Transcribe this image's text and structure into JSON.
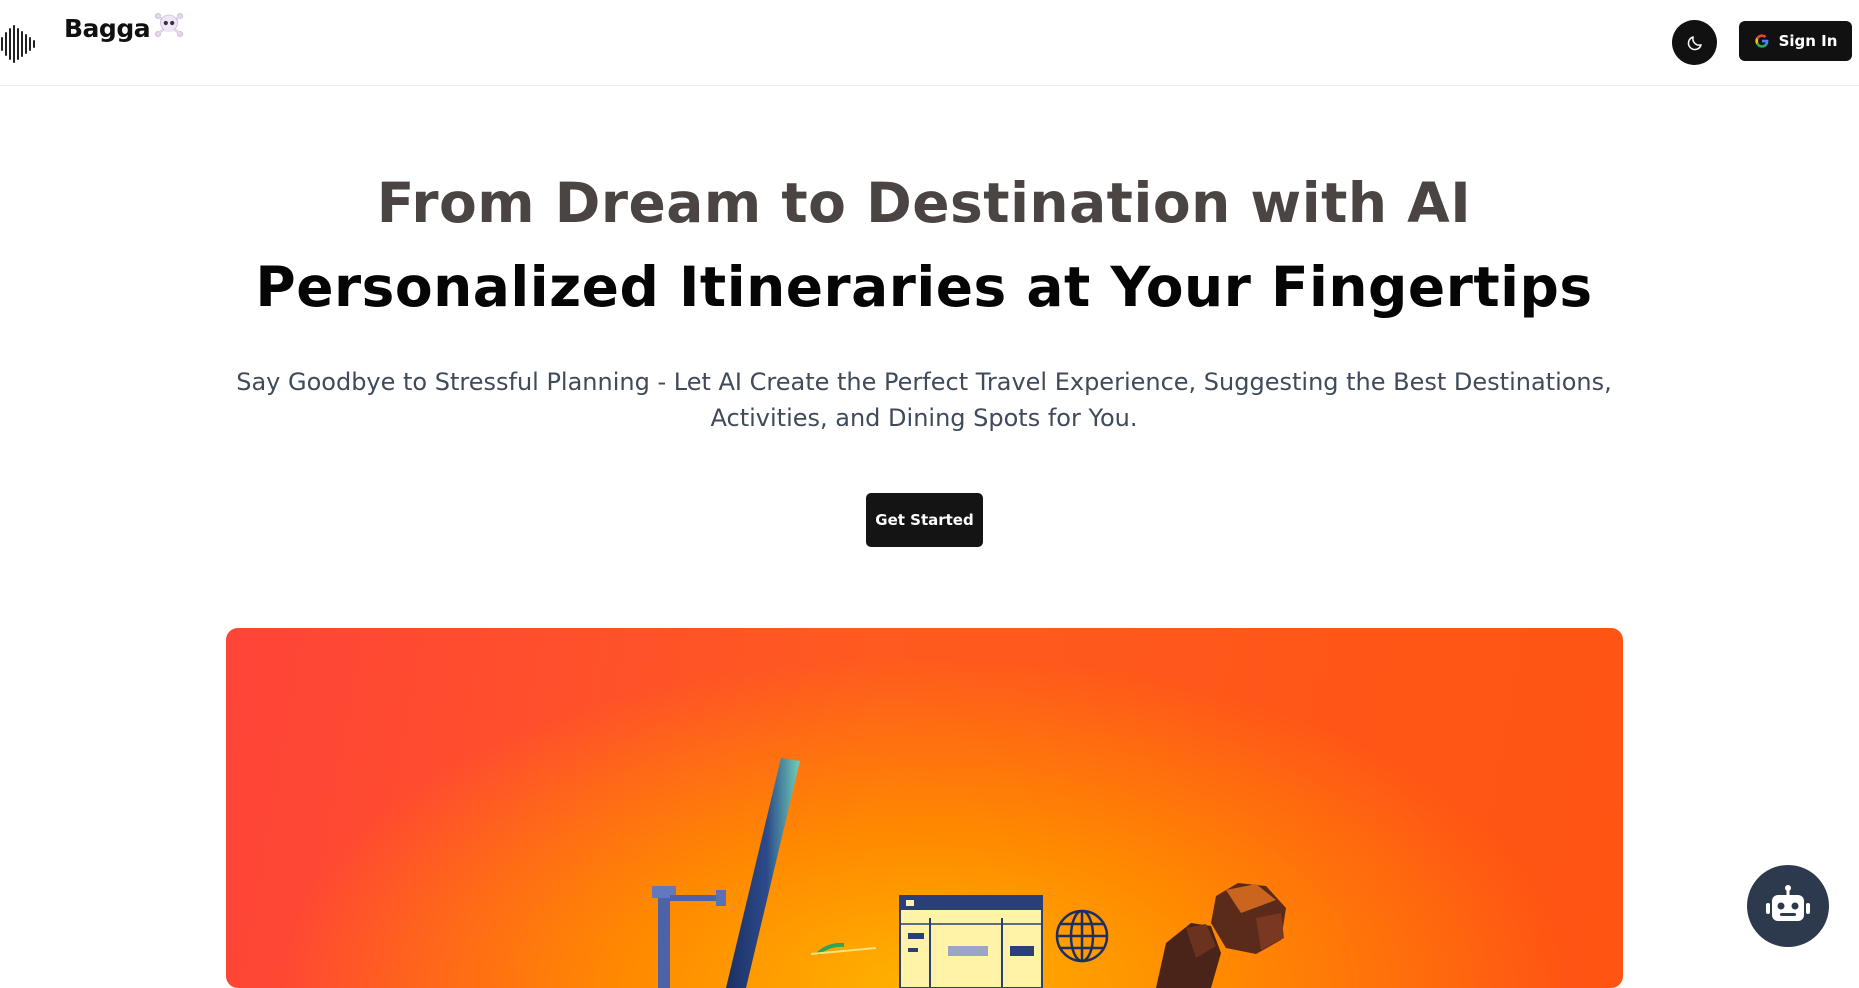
{
  "header": {
    "brand": "Bagga",
    "brand_emoji": "☠️",
    "theme_toggle_icon": "moon-icon",
    "signin_label": "Sign In",
    "signin_icon": "google-icon"
  },
  "hero": {
    "title_line1": "From Dream to Destination with AI",
    "title_line2": "Personalized Itineraries at Your Fingertips",
    "subtitle_line1": "Say Goodbye to Stressful Planning - Let AI Create the Perfect Travel Experience, Suggesting the Best Destinations,",
    "subtitle_line2": "Activities, and Dining Spots for You.",
    "cta_label": "Get Started"
  },
  "banner": {
    "illustration": "travel-illustration",
    "colors": {
      "top_left": "#ff4438",
      "right": "#ff5412",
      "bottom_glow": "#ffb300"
    }
  },
  "chat_widget": {
    "icon": "robot-icon"
  }
}
